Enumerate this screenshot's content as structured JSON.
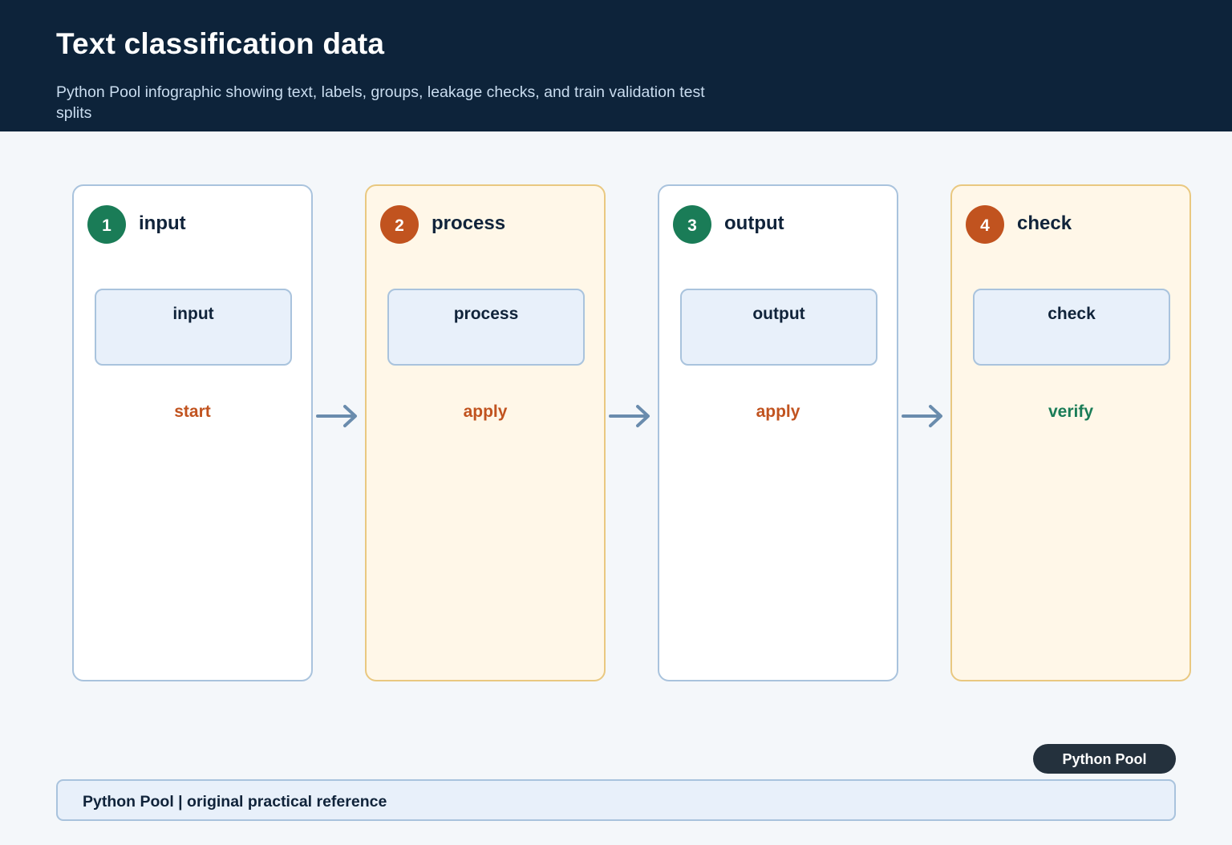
{
  "header": {
    "title": "Text classification data",
    "subtitle": "Python Pool infographic showing text, labels, groups, leakage checks, and train validation test splits"
  },
  "steps": [
    {
      "number": "1",
      "title": "input",
      "box_label": "input",
      "action": "start"
    },
    {
      "number": "2",
      "title": "process",
      "box_label": "process",
      "action": "apply"
    },
    {
      "number": "3",
      "title": "output",
      "box_label": "output",
      "action": "apply"
    },
    {
      "number": "4",
      "title": "check",
      "box_label": "check",
      "action": "verify"
    }
  ],
  "brand_pill": "Python Pool",
  "footer": {
    "text": "Python Pool | original practical reference"
  },
  "colors": {
    "header_bg": "#0d233a",
    "accent_green": "#1a7c57",
    "accent_orange": "#c1531f",
    "card_border": "#a9c3dd",
    "alt_card_bg": "#fff7e8",
    "arrow": "#6a8cad"
  }
}
